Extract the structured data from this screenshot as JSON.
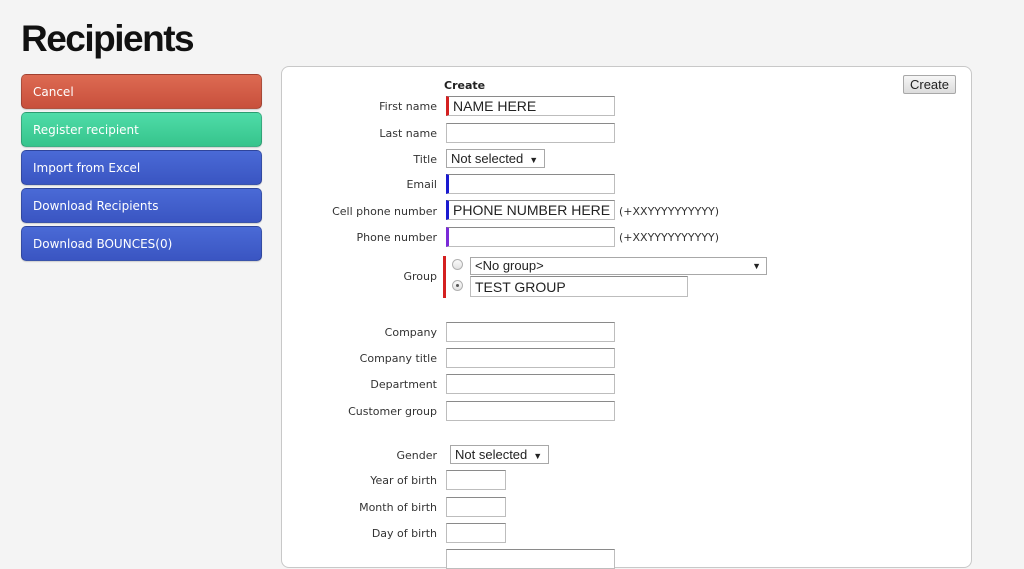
{
  "page": {
    "title": "Recipients"
  },
  "sidebar": {
    "buttons": [
      {
        "label": "Cancel",
        "color": "#d65d47"
      },
      {
        "label": "Register recipient",
        "color": "#3fd19a"
      },
      {
        "label": "Import from Excel",
        "color": "#3f5fcc"
      },
      {
        "label": "Download Recipients",
        "color": "#3f5fcc"
      },
      {
        "label": "Download BOUNCES(0)",
        "color": "#3f5fcc"
      }
    ]
  },
  "form": {
    "heading": "Create",
    "create_button": "Create",
    "fields": {
      "first_name": {
        "label": "First name",
        "value": "NAME HERE",
        "marker_color": "#d42020"
      },
      "last_name": {
        "label": "Last name",
        "value": ""
      },
      "title": {
        "label": "Title",
        "selected": "Not selected"
      },
      "email": {
        "label": "Email",
        "value": "",
        "marker_color": "#1a1ad0"
      },
      "cell_phone": {
        "label": "Cell phone number",
        "value": "PHONE NUMBER HERE",
        "hint": "(+XXYYYYYYYYYY)",
        "marker_color": "#1a1ad0"
      },
      "phone": {
        "label": "Phone number",
        "value": "",
        "hint": "(+XXYYYYYYYYYY)",
        "marker_color": "#7a2ad8"
      },
      "group": {
        "label": "Group",
        "marker_color": "#d42020",
        "options": [
          {
            "type": "select",
            "selected": "<No group>",
            "checked": false
          },
          {
            "type": "text",
            "value": "TEST GROUP",
            "checked": true
          }
        ]
      },
      "company": {
        "label": "Company",
        "value": ""
      },
      "company_title": {
        "label": "Company title",
        "value": ""
      },
      "department": {
        "label": "Department",
        "value": ""
      },
      "customer_group": {
        "label": "Customer group",
        "value": ""
      },
      "gender": {
        "label": "Gender",
        "selected": "Not selected"
      },
      "year_of_birth": {
        "label": "Year of birth",
        "value": ""
      },
      "month_of_birth": {
        "label": "Month of birth",
        "value": ""
      },
      "day_of_birth": {
        "label": "Day of birth",
        "value": ""
      }
    }
  }
}
